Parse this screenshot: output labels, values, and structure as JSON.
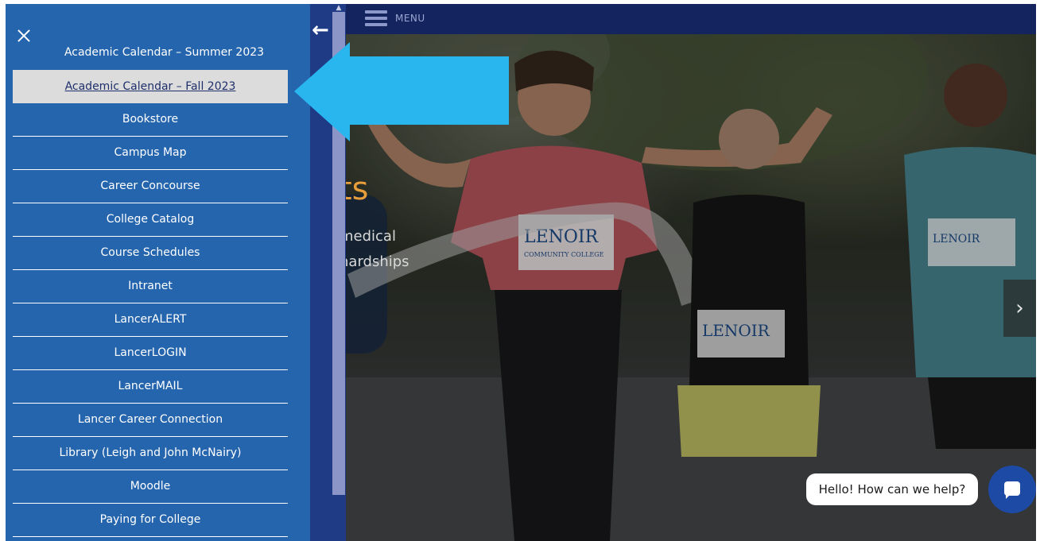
{
  "menu": {
    "label": "MENU"
  },
  "sidebar": {
    "summer_link": "Academic Calendar – Summer 2023",
    "items": [
      {
        "label": "Academic Calendar – Fall 2023",
        "active": true
      },
      {
        "label": "Bookstore"
      },
      {
        "label": "Campus Map"
      },
      {
        "label": "Career Concourse"
      },
      {
        "label": "College Catalog"
      },
      {
        "label": "Course Schedules"
      },
      {
        "label": "Intranet"
      },
      {
        "label": "LancerALERT"
      },
      {
        "label": "LancerLOGIN"
      },
      {
        "label": "LancerMAIL"
      },
      {
        "label": "Lancer Career Connection"
      },
      {
        "label": "Library (Leigh and John McNairy)"
      },
      {
        "label": "Moodle"
      },
      {
        "label": "Paying for College"
      }
    ]
  },
  "hero": {
    "heading_fragment": "ts",
    "line1_fragment": "medical",
    "line2_fragment": "hardships",
    "bib_text": "LENOIR",
    "bib_subtext": "COMMUNITY COLLEGE"
  },
  "chat": {
    "prompt": "Hello! How can we help?"
  },
  "colors": {
    "sidebar_bg": "#2565ae",
    "topbar_bg": "#14245e",
    "active_item_bg": "#dcdcdc",
    "arrow": "#29b6ee",
    "hero_heading": "#e79e3b"
  },
  "icons": {
    "close": "close-icon",
    "back": "arrow-left-icon",
    "menu": "hamburger-icon",
    "next": "chevron-right-icon",
    "chat": "chat-icon"
  }
}
